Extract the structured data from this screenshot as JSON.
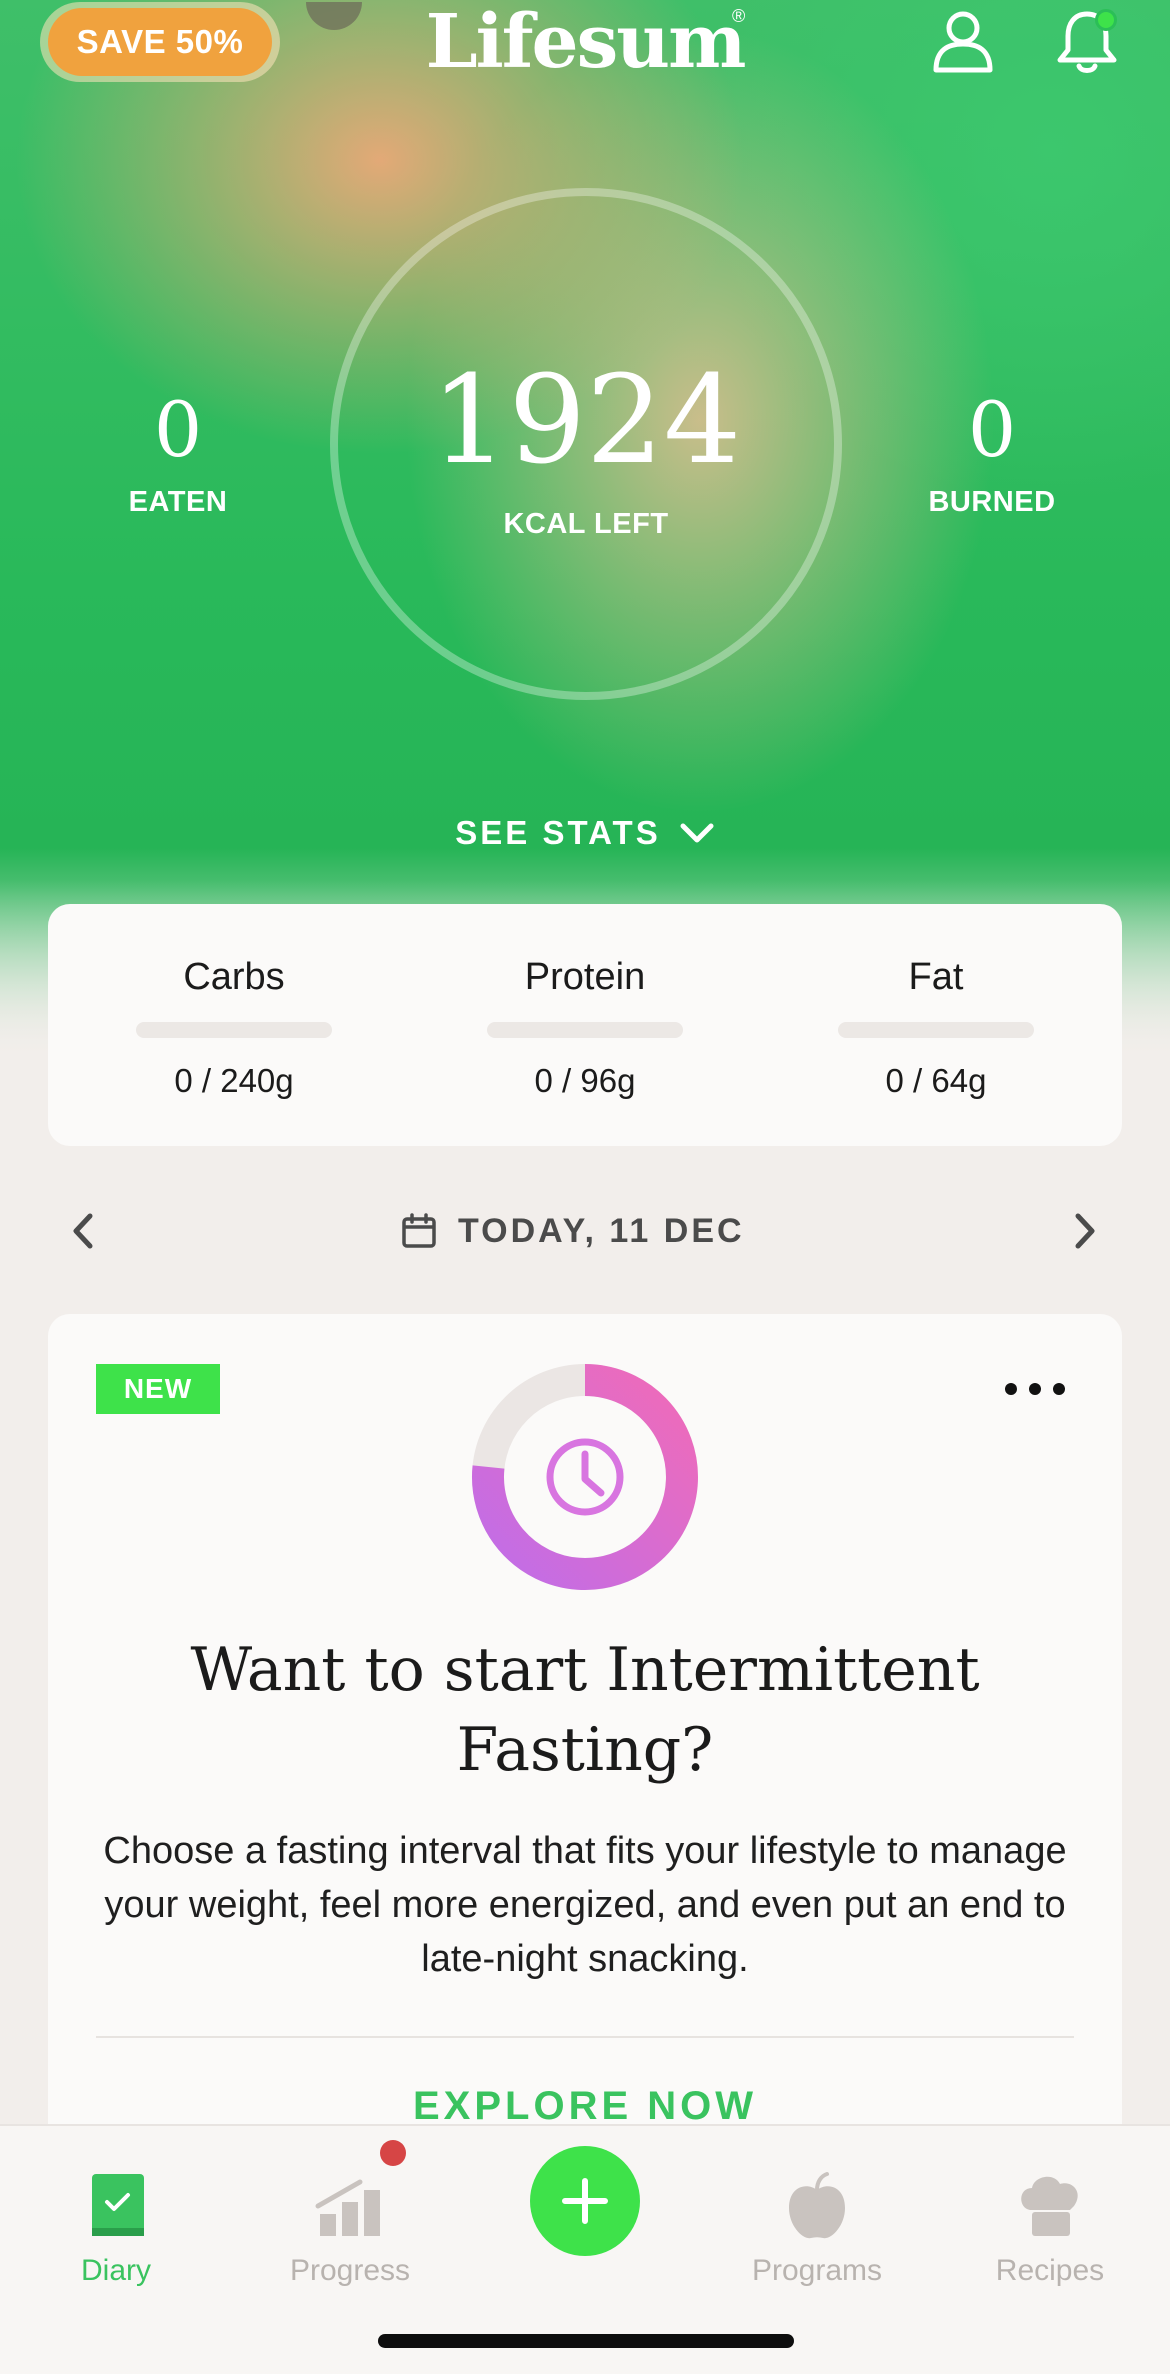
{
  "header": {
    "promo_label": "SAVE 50%",
    "logo_text": "Lifesum",
    "logo_reg": "®"
  },
  "summary": {
    "kcal_left": "1924",
    "kcal_left_label": "KCAL LEFT",
    "eaten_value": "0",
    "eaten_label": "EATEN",
    "burned_value": "0",
    "burned_label": "BURNED",
    "see_stats_label": "SEE STATS"
  },
  "macros": [
    {
      "name": "Carbs",
      "value": "0 / 240g",
      "progress": 0
    },
    {
      "name": "Protein",
      "value": "0 / 96g",
      "progress": 0
    },
    {
      "name": "Fat",
      "value": "0 / 64g",
      "progress": 0
    }
  ],
  "date_nav": {
    "label": "TODAY, 11 DEC"
  },
  "fasting_card": {
    "badge": "NEW",
    "title": "Want to start Intermittent Fasting?",
    "body": "Choose a fasting interval that fits your lifestyle to manage your weight, feel more energized, and even put an end to late-night snacking.",
    "cta": "EXPLORE NOW"
  },
  "tabbar": {
    "tabs": [
      {
        "label": "Diary",
        "icon": "diary-book-icon",
        "active": true
      },
      {
        "label": "Progress",
        "icon": "progress-chart-icon",
        "active": false
      },
      {
        "label": "Programs",
        "icon": "apple-icon",
        "active": false
      },
      {
        "label": "Recipes",
        "icon": "chef-hat-icon",
        "active": false
      }
    ],
    "add_icon": "plus-icon"
  },
  "colors": {
    "accent_green": "#3ee24a",
    "text_green": "#3ac35f",
    "promo_orange": "#f0a23e",
    "fasting_pink": "#f06bb8",
    "fasting_purple": "#c06de8"
  }
}
